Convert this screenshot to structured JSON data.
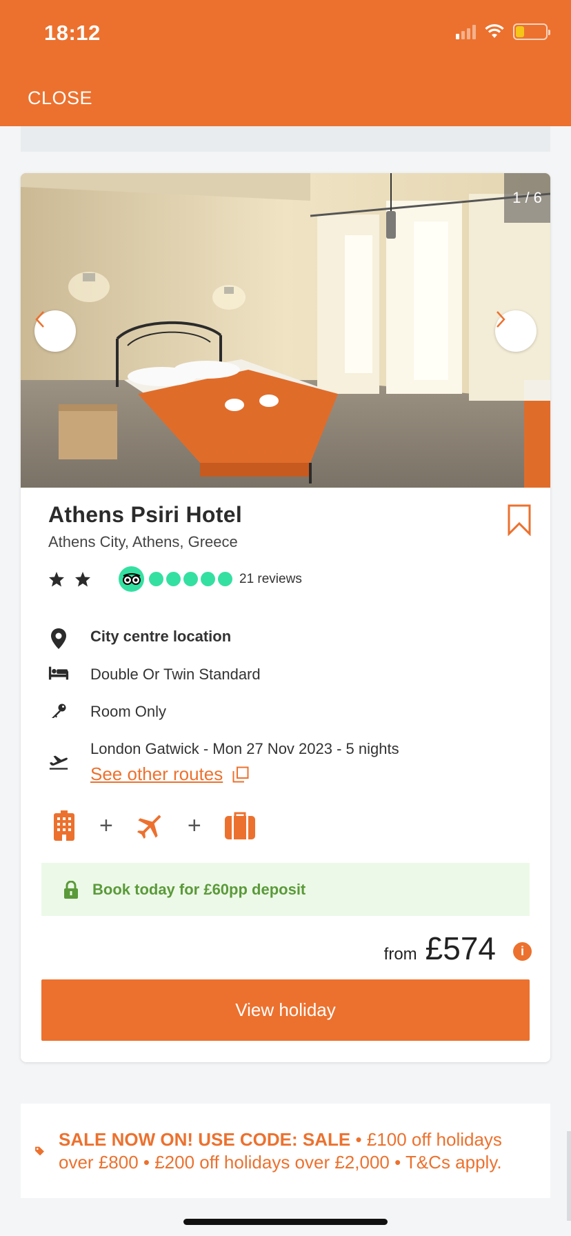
{
  "status_bar": {
    "time": "18:12"
  },
  "header": {
    "close_label": "CLOSE"
  },
  "gallery": {
    "counter": "1 / 6"
  },
  "hotel": {
    "name": "Athens Psiri Hotel",
    "location": "Athens City, Athens, Greece",
    "star_rating": 2,
    "tripadvisor_rating": 5,
    "reviews": "21 reviews"
  },
  "features": {
    "location": "City centre location",
    "room": "Double Or Twin Standard",
    "board": "Room Only",
    "flight": "London Gatwick - Mon 27 Nov 2023 - 5 nights",
    "routes_link": "See other routes"
  },
  "deposit": {
    "text": "Book today for £60pp deposit"
  },
  "price": {
    "from_label": "from",
    "amount": "£574"
  },
  "cta": {
    "view_label": "View holiday"
  },
  "sale": {
    "headline": "SALE NOW ON! USE CODE: SALE",
    "details": " • £100 off holidays over £800 • £200 off holidays over £2,000 • T&Cs apply."
  },
  "colors": {
    "accent": "#ec712e",
    "deposit_bg": "#edf9e8",
    "deposit_text": "#5a9a3a",
    "tripadvisor": "#34e0a1"
  }
}
